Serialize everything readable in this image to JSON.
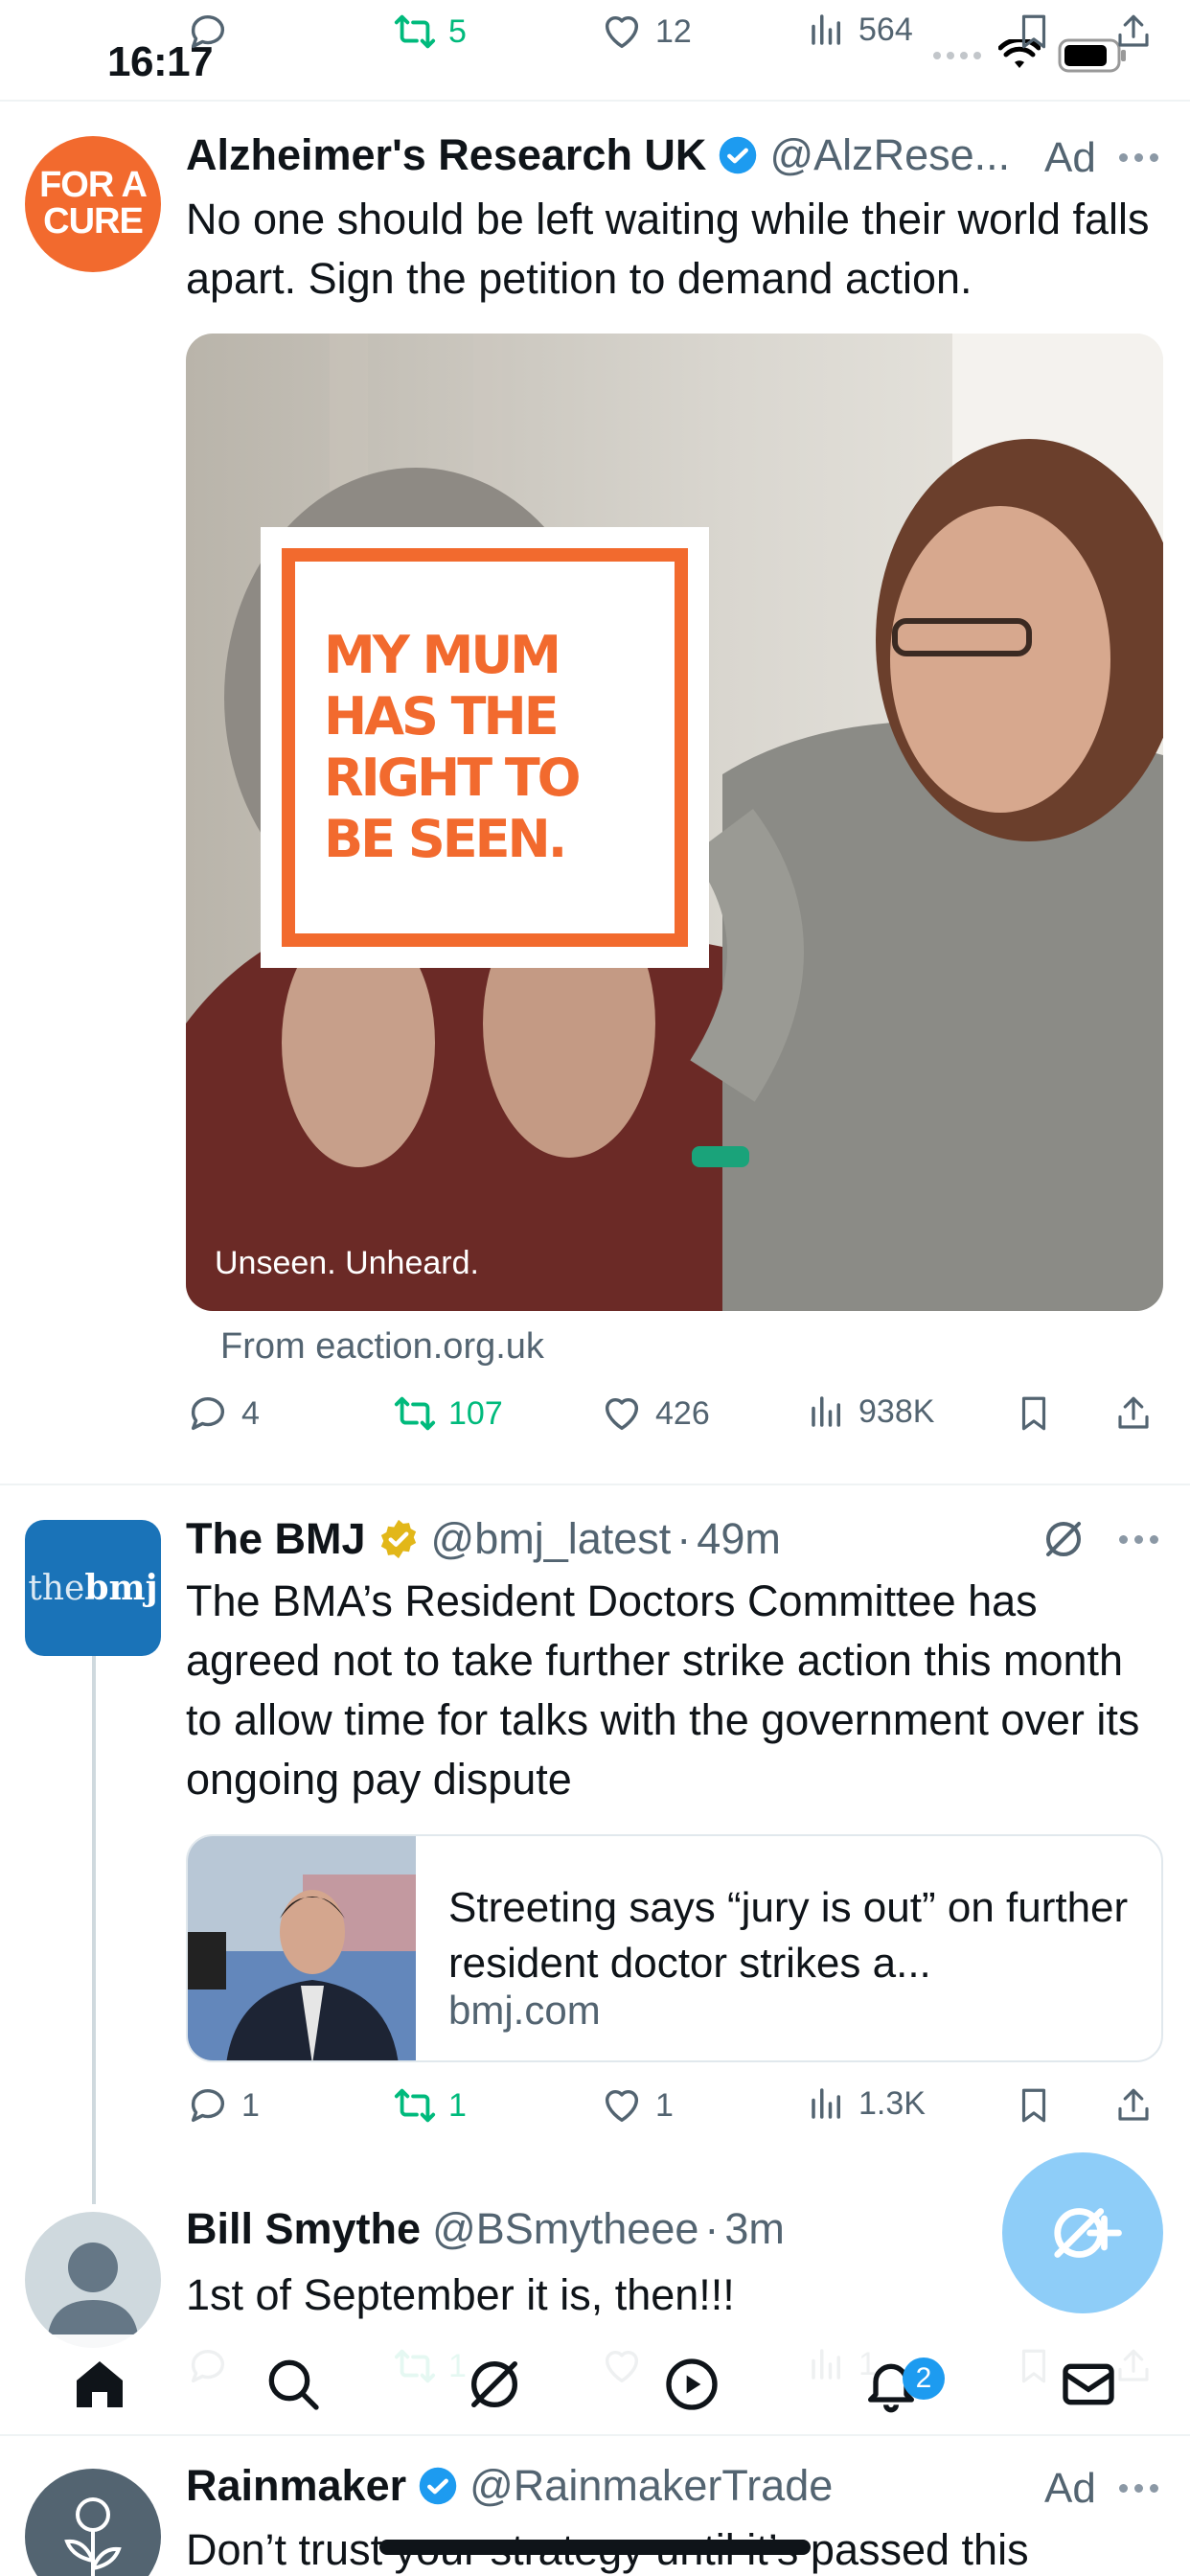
{
  "status_bar": {
    "time": "16:17"
  },
  "prev_tweet_actions": {
    "replies": "",
    "retweets": "5",
    "likes": "12",
    "views": "564"
  },
  "ad_tweet": {
    "avatar_text_line1": "FOR A",
    "avatar_text_line2": "CURE",
    "name": "Alzheimer's Research UK",
    "handle": "@AlzRese...",
    "ad_label": "Ad",
    "text": "No one should be left waiting while their world falls apart. Sign the petition to demand action.",
    "media_caption": "Unseen. Unheard.",
    "sign_line1": "MY MUM",
    "sign_line2": "HAS THE",
    "sign_line3": "RIGHT TO",
    "sign_line4": "BE SEEN.",
    "from": "From eaction.org.uk",
    "actions": {
      "replies": "4",
      "retweets": "107",
      "likes": "426",
      "views": "938K"
    }
  },
  "bmj_tweet": {
    "avatar_text_light": "the",
    "avatar_text_bold": "bmj",
    "name": "The BMJ",
    "handle": "@bmj_latest",
    "time": "49m",
    "text": "The BMA’s Resident Doctors Committee has agreed not to take further strike action this month to allow time for talks with the government over its ongoing pay dispute",
    "card_title": "Streeting says “jury is out” on further resident doctor strikes a...",
    "card_domain": "bmj.com",
    "actions": {
      "replies": "1",
      "retweets": "1",
      "likes": "1",
      "views": "1.3K"
    }
  },
  "bill_tweet": {
    "name": "Bill Smythe",
    "handle": "@BSmytheee",
    "time": "3m",
    "text": "1st of September it is, then!!!",
    "actions": {
      "replies": "",
      "retweets": "1",
      "likes": "",
      "views": "1"
    }
  },
  "rainmaker_tweet": {
    "name": "Rainmaker",
    "handle": "@RainmakerTrade",
    "ad_label": "Ad",
    "text": "Don’t trust your strategy until it’s passed this"
  },
  "bottom_nav": {
    "notifications_badge": "2"
  },
  "colors": {
    "accent": "#1d9bf0",
    "retweet_green": "#00ba7c",
    "ad_orange": "#f26a2e",
    "bmj_blue": "#1a73b8",
    "fab_blue": "#8ecdf8"
  }
}
